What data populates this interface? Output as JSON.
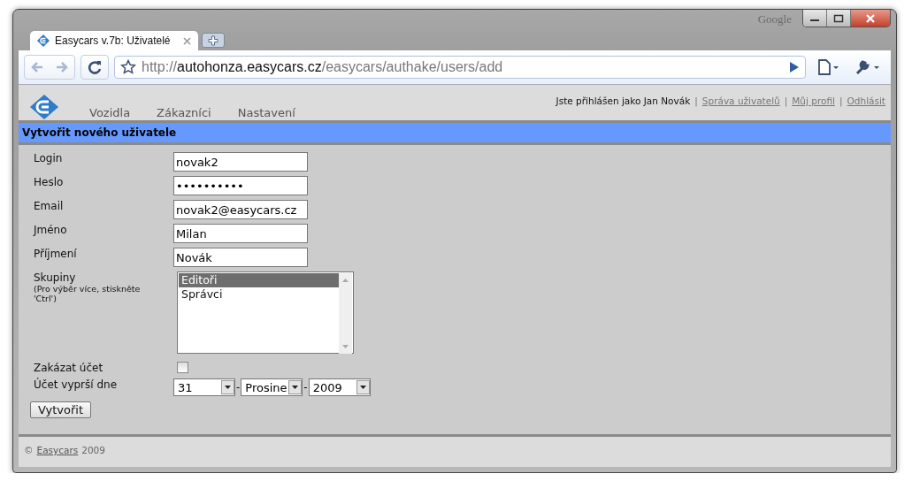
{
  "window": {
    "brand": "Google"
  },
  "tabs": [
    {
      "label": "Easycars v.7b: Uživatelé",
      "selected": true
    }
  ],
  "address": {
    "scheme": "http://",
    "host": "autohonza.easycars.cz",
    "path": "/easycars/authake/users/add"
  },
  "user_bar": [
    {
      "kind": "text",
      "text": "Jste přihlášen jako Jan Novák"
    },
    {
      "kind": "separator",
      "text": "|"
    },
    {
      "kind": "link",
      "text": "Správa uživatelů"
    },
    {
      "kind": "separator",
      "text": "|"
    },
    {
      "kind": "link",
      "text": "Můj profil"
    },
    {
      "kind": "separator",
      "text": "|"
    },
    {
      "kind": "link",
      "text": "Odhlásit"
    }
  ],
  "menu": [
    "Vozidla",
    "Zákazníci",
    "Nastavení"
  ],
  "page_title": "Vytvořit nového uživatele",
  "form": [
    {
      "kind": "text",
      "label": "Login",
      "value": "novak2"
    },
    {
      "kind": "text",
      "label": "Heslo",
      "value": "••••••••••"
    },
    {
      "kind": "text",
      "label": "Email",
      "value": "novak2@easycars.cz"
    },
    {
      "kind": "text",
      "label": "Jméno",
      "value": "Milan"
    },
    {
      "kind": "text",
      "label": "Příjmení",
      "value": "Novák"
    },
    {
      "kind": "listbox",
      "label": "Skupiny",
      "hint": "(Pro výběr více, stiskněte 'Ctrl')",
      "options": [
        {
          "label": "Editoři",
          "selected": true
        },
        {
          "label": "Správci",
          "selected": false
        }
      ]
    },
    {
      "kind": "checkbox",
      "label": "Zakázat účet",
      "checked": false
    },
    {
      "kind": "date",
      "label": "Účet vyprší dne",
      "parts": [
        {
          "kind": "select",
          "text": "31"
        },
        {
          "kind": "separator",
          "text": "-"
        },
        {
          "kind": "select",
          "text": "Prosine"
        },
        {
          "kind": "separator",
          "text": "-"
        },
        {
          "kind": "select",
          "text": "2009"
        }
      ]
    }
  ],
  "submit": "Vytvořit",
  "footer": {
    "copyright": "©",
    "link": "Easycars",
    "year": "2009"
  }
}
